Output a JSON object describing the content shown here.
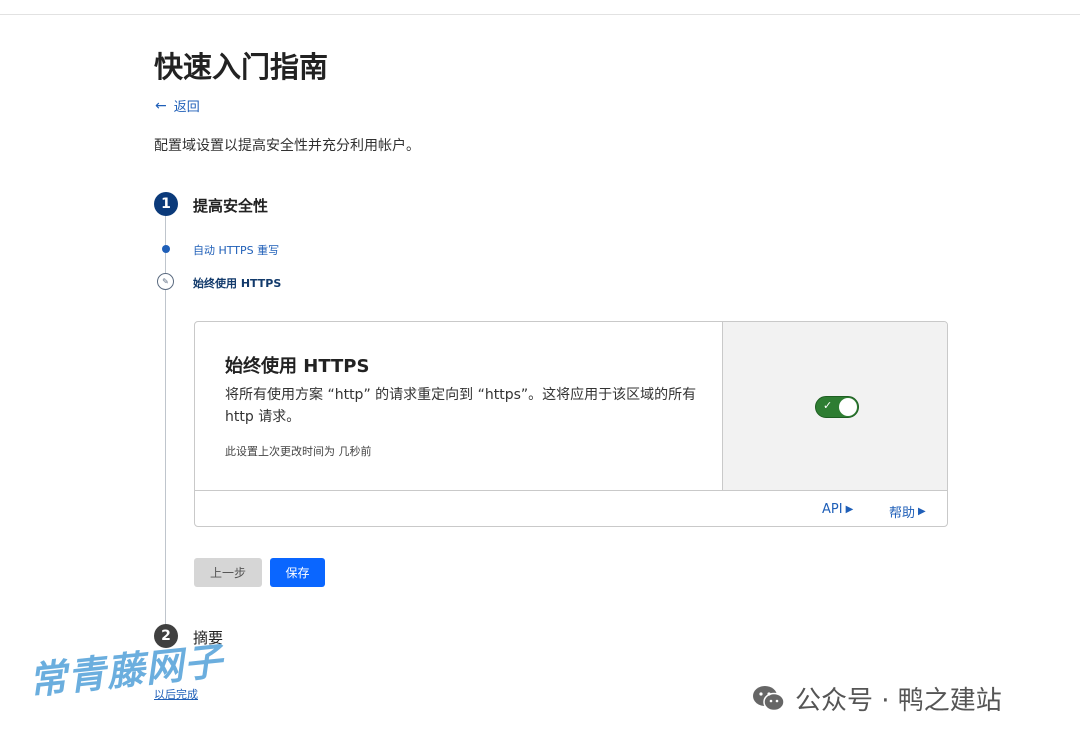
{
  "page": {
    "title": "快速入门指南",
    "back_label": "返回",
    "intro": "配置域设置以提高安全性并充分利用帐户。"
  },
  "steps": [
    {
      "number": "1",
      "title": "提高安全性",
      "sub_items": [
        {
          "label": "自动 HTTPS 重写",
          "status": "done"
        },
        {
          "label": "始终使用 HTTPS",
          "status": "current"
        }
      ]
    },
    {
      "number": "2",
      "title": "摘要"
    }
  ],
  "card": {
    "title": "始终使用 HTTPS",
    "description": "将所有使用方案 “http” 的请求重定向到 “https”。这将应用于该区域的所有 http 请求。",
    "last_changed": "此设置上次更改时间为 几秒前",
    "toggle_on": true,
    "footer_api": "API",
    "footer_help": "帮助"
  },
  "buttons": {
    "prev": "上一步",
    "save": "保存"
  },
  "finish_link": "以后完成",
  "watermarks": {
    "left": "常青藤网子",
    "right": "公众号 · 鸭之建站"
  },
  "colors": {
    "link": "#1f5fb8",
    "primary": "#0a66ff",
    "toggle_on": "#2e7d32",
    "step_active": "#0b3a7a"
  }
}
